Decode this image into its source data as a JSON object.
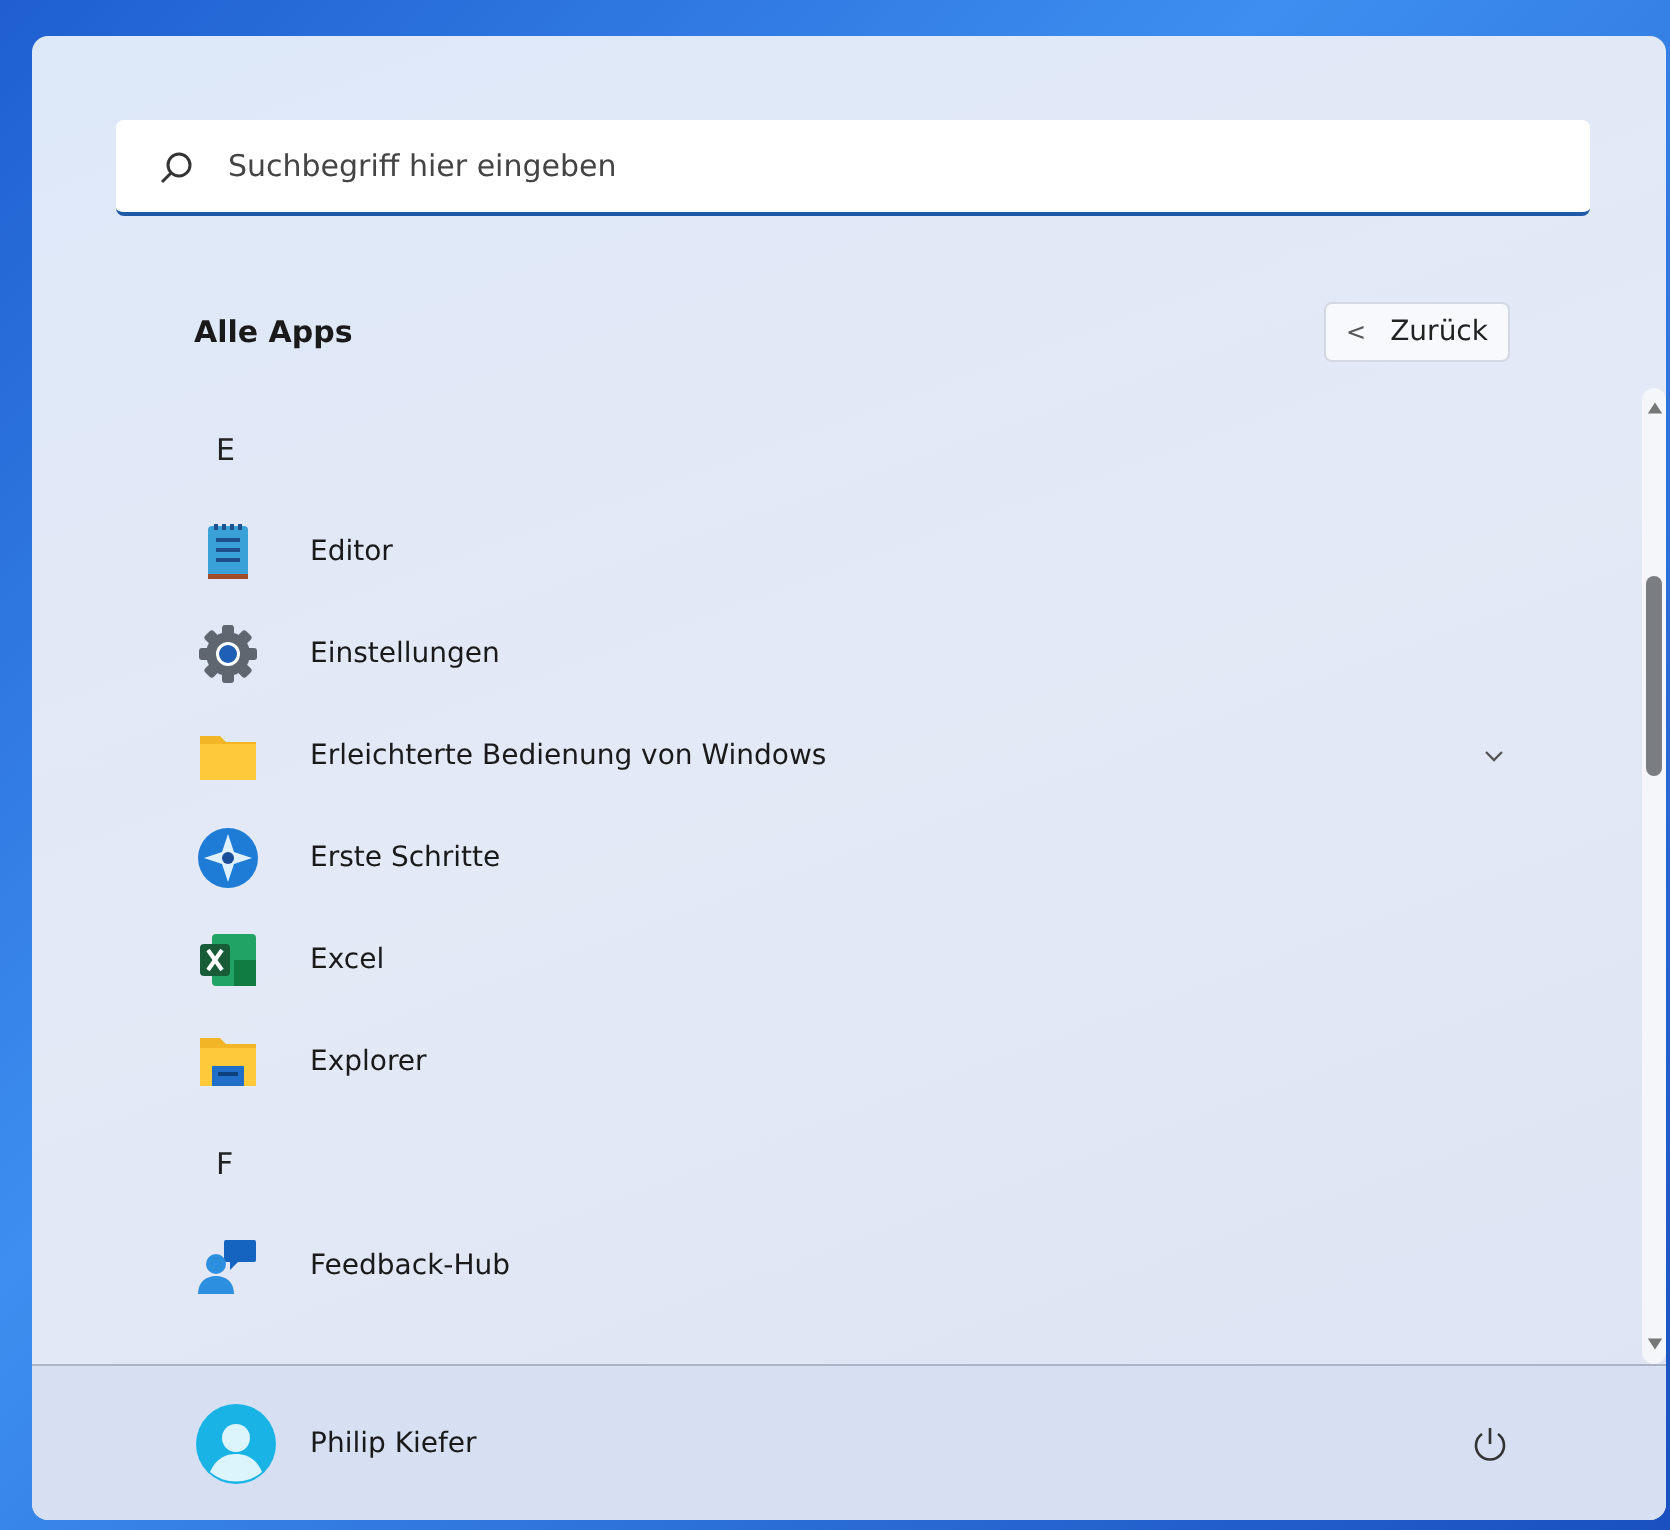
{
  "search": {
    "placeholder": "Suchbegriff hier eingeben"
  },
  "header": {
    "title": "Alle Apps",
    "back_button": {
      "icon": "<",
      "label": "Zurück"
    }
  },
  "apps": [
    {
      "kind": "letter",
      "label": "E"
    },
    {
      "kind": "app",
      "label": "Editor"
    },
    {
      "kind": "app",
      "label": "Einstellungen"
    },
    {
      "kind": "group",
      "label": "Erleichterte Bedienung von Windows"
    },
    {
      "kind": "app",
      "label": "Erste Schritte"
    },
    {
      "kind": "app",
      "label": "Excel"
    },
    {
      "kind": "app",
      "label": "Explorer"
    },
    {
      "kind": "letter",
      "label": "F"
    },
    {
      "kind": "app",
      "label": "Feedback-Hub"
    }
  ],
  "footer": {
    "user": "Philip Kiefer"
  }
}
